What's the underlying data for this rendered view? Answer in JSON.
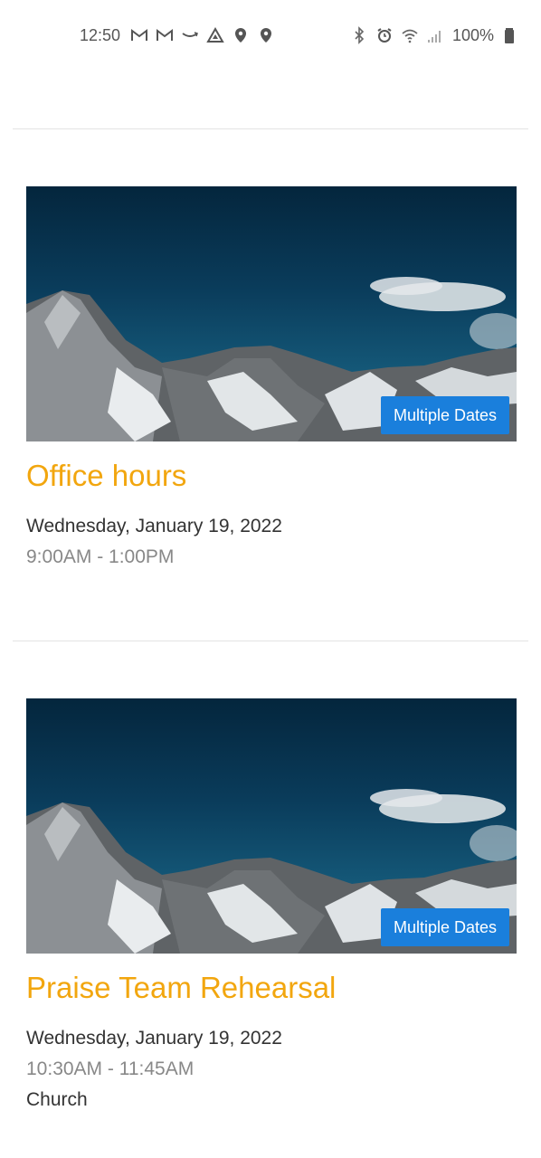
{
  "status_bar": {
    "time": "12:50",
    "battery_percent": "100%",
    "left_icons": [
      "gmail-icon",
      "gmail-icon",
      "amazon-icon",
      "drive-icon",
      "location-pin-icon",
      "location-pin-icon"
    ],
    "right_icons": [
      "bluetooth-icon",
      "alarm-icon",
      "wifi-icon",
      "cellular-signal-icon",
      "battery-icon"
    ]
  },
  "events": [
    {
      "title": "Office hours",
      "badge": "Multiple Dates",
      "date": "Wednesday, January 19, 2022",
      "time": "9:00AM - 1:00PM"
    },
    {
      "title": "Praise Team Rehearsal",
      "badge": "Multiple Dates",
      "date": "Wednesday, January 19, 2022",
      "time": "10:30AM - 11:45AM",
      "location": "Church"
    }
  ],
  "colors": {
    "title": "#f2a60e",
    "badge_bg": "#1a7fdc",
    "date_text": "#333333",
    "time_text": "#888888"
  }
}
